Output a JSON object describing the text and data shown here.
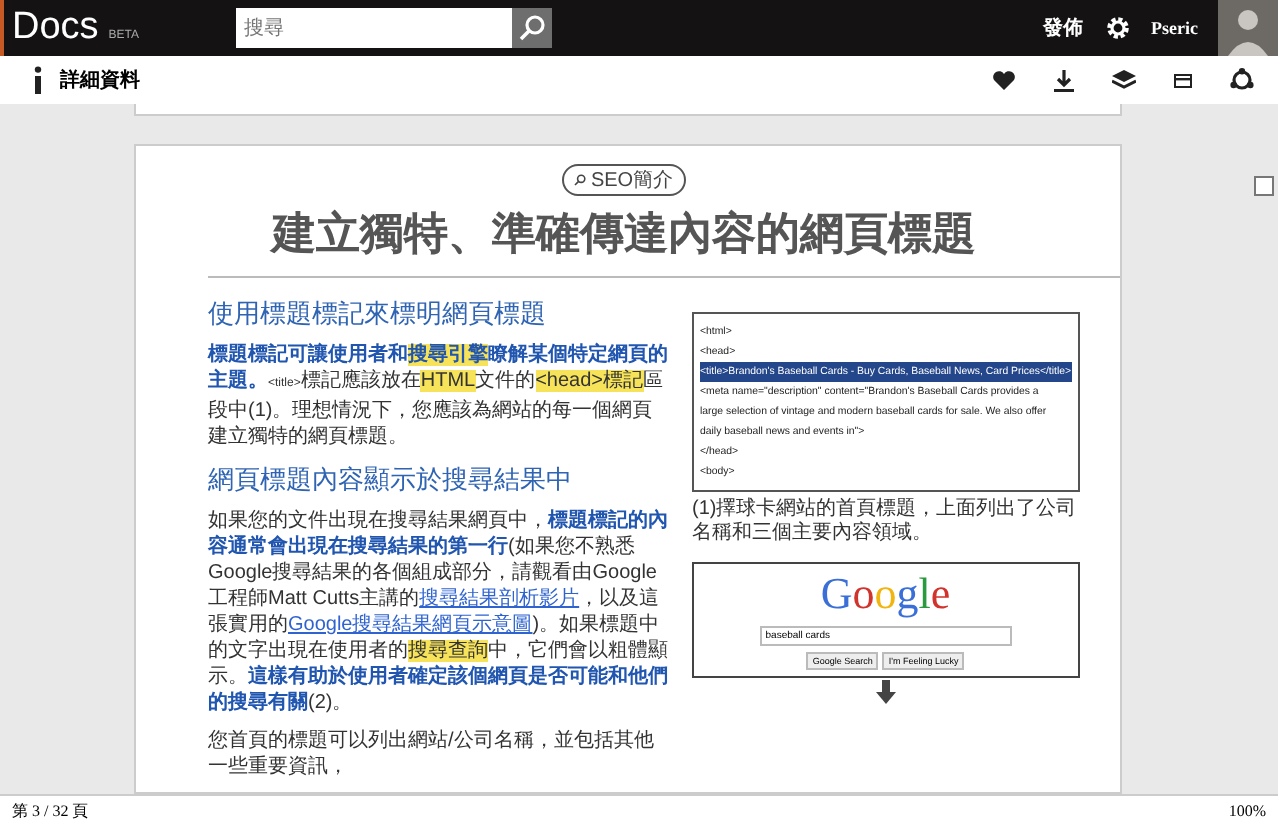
{
  "topbar": {
    "logo": "Docs",
    "logo_badge": "BETA",
    "search": {
      "placeholder": "搜尋"
    },
    "publish": "發佈",
    "user": "Pseric"
  },
  "toolbar": {
    "title": "詳細資料"
  },
  "document": {
    "tag": "SEO簡介",
    "title": "建立獨特、準確傳達內容的網頁標題",
    "sections": [
      {
        "heading": "使用標題標記來標明網頁標題",
        "segments": [
          {
            "kind": "bold",
            "text": "標題標記可讓使用者和"
          },
          {
            "kind": "bold-highlight",
            "text": "搜尋引擎"
          },
          {
            "kind": "bold",
            "text": "瞭解某個特定網頁的主題。"
          },
          {
            "kind": "code",
            "text": "<title>"
          },
          {
            "kind": "plain",
            "text": "標記應該放在"
          },
          {
            "kind": "highlight",
            "text": "HTML"
          },
          {
            "kind": "plain",
            "text": "文件的"
          },
          {
            "kind": "highlight",
            "text": "<head>標記"
          },
          {
            "kind": "plain",
            "text": "區段中(1)。理想情況下，您應該為網站的每一個網頁建立獨特的網頁標題。"
          }
        ]
      },
      {
        "heading": "網頁標題內容顯示於搜尋結果中",
        "segments": [
          {
            "kind": "plain",
            "text": "如果您的文件出現在搜尋結果網頁中，"
          },
          {
            "kind": "bold",
            "text": "標題標記的內容通常會出現在搜尋結果的第一行"
          },
          {
            "kind": "plain",
            "text": "(如果您不熟悉Google搜尋結果的各個組成部分，請觀看由Google工程師Matt Cutts主講的"
          },
          {
            "kind": "link",
            "text": "搜尋結果剖析影片"
          },
          {
            "kind": "plain",
            "text": "，以及這張實用的"
          },
          {
            "kind": "link",
            "text": "Google搜尋結果網頁示意圖"
          },
          {
            "kind": "plain",
            "text": ")。如果標題中的文字出現在使用者的"
          },
          {
            "kind": "highlight",
            "text": "搜尋查詢"
          },
          {
            "kind": "plain",
            "text": "中，它們會以粗體顯示。"
          },
          {
            "kind": "bold",
            "text": "這樣有助於使用者確定該個網頁是否可能和他們的搜尋有關"
          },
          {
            "kind": "plain",
            "text": "(2)。"
          }
        ]
      },
      {
        "segments": [
          {
            "kind": "plain",
            "text": "您首頁的標題可以列出網站/公司名稱，並包括其他一些重要資訊，"
          }
        ]
      }
    ],
    "code_lines": [
      {
        "text": "<html>",
        "highlighted": false
      },
      {
        "text": "<head>",
        "highlighted": false
      },
      {
        "text": "<title>Brandon's Baseball Cards - Buy Cards, Baseball News, Card Prices</title>",
        "highlighted": true
      },
      {
        "text": "<meta name=\"description\" content=\"Brandon's Baseball Cards provides a",
        "highlighted": false
      },
      {
        "text": "large selection of vintage and modern baseball cards for sale. We also offer",
        "highlighted": false
      },
      {
        "text": "daily baseball news and events in\">",
        "highlighted": false
      },
      {
        "text": "</head>",
        "highlighted": false
      },
      {
        "text": "<body>",
        "highlighted": false
      }
    ],
    "caption": "(1)擇球卡網站的首頁標題，上面列出了公司名稱和三個主要內容領域。",
    "google": {
      "logo": "Google",
      "query": "baseball cards",
      "buttons": [
        "Google Search",
        "I'm Feeling Lucky"
      ]
    }
  },
  "status_bar": {
    "page": "第 3 / 32 頁",
    "zoom": "100%"
  }
}
